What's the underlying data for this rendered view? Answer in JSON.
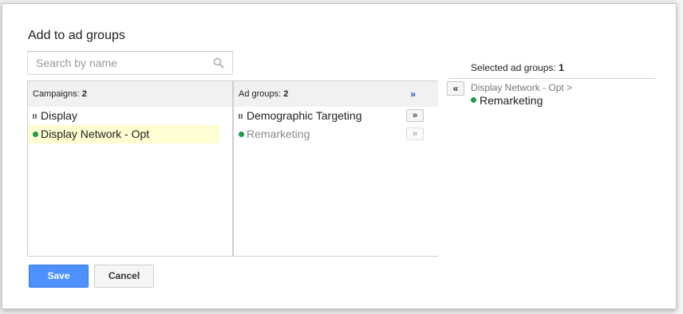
{
  "dialog": {
    "title": "Add to ad groups"
  },
  "search": {
    "placeholder": "Search by name"
  },
  "campaigns": {
    "label": "Campaigns:",
    "count": "2",
    "items": [
      {
        "name": "Display",
        "status": "paused",
        "icon": "pause-icon"
      },
      {
        "name": "Display Network - Opt",
        "status": "enabled",
        "icon": "green-dot-icon"
      }
    ]
  },
  "ad_groups": {
    "label": "Ad groups:",
    "count": "2",
    "add_all_label": "»",
    "items": [
      {
        "name": "Demographic Targeting",
        "status": "paused",
        "icon": "pause-icon",
        "add_label": "»"
      },
      {
        "name": "Remarketing",
        "status": "enabled",
        "icon": "green-dot-icon",
        "add_label": "»",
        "already_selected": true
      }
    ]
  },
  "selected": {
    "label": "Selected ad groups:",
    "count": "1",
    "remove_label": "«",
    "items": [
      {
        "path": "Display Network - Opt >",
        "name": "Remarketing",
        "icon": "green-dot-icon"
      }
    ]
  },
  "actions": {
    "save_label": "Save",
    "cancel_label": "Cancel"
  },
  "colors": {
    "primary": "#4d90fe",
    "enabled_dot": "#1e9b4b",
    "highlight": "#fefed2",
    "link": "#1155cc"
  }
}
